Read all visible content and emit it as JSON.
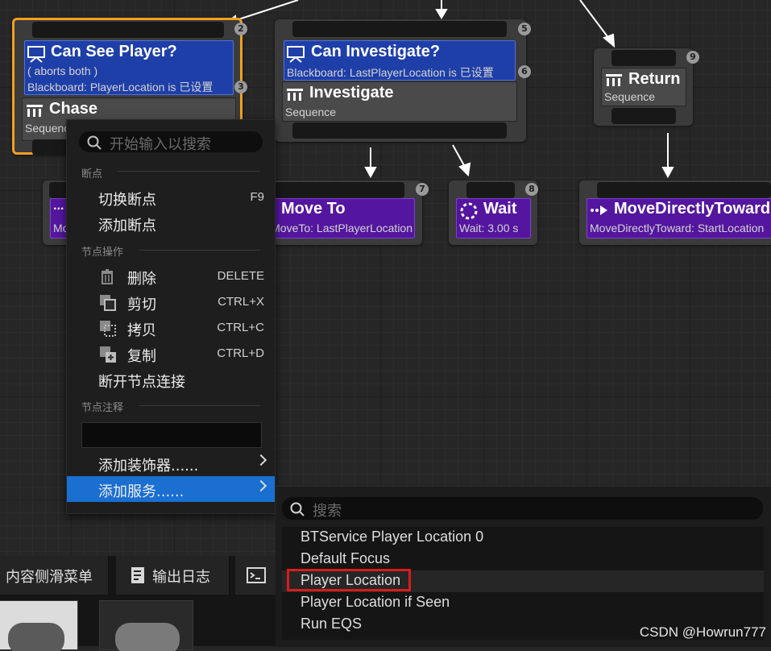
{
  "nodes": {
    "can_see_player": {
      "badge_top": "2",
      "badge_deco": "3",
      "decorator_title": "Can See Player?",
      "decorator_line1": "( aborts both )",
      "decorator_line2": "Blackboard: PlayerLocation is 已设置",
      "composite_title": "Chase",
      "composite_sub": "Sequence"
    },
    "can_investigate": {
      "badge_top": "5",
      "badge_deco": "6",
      "decorator_title": "Can Investigate?",
      "decorator_line1": "Blackboard: LastPlayerLocation is 已设置",
      "composite_title": "Investigate",
      "composite_sub": "Sequence"
    },
    "return": {
      "badge": "9",
      "title": "Return",
      "sub": "Sequence"
    },
    "left_task": {
      "title": "...",
      "sub": "Mo"
    },
    "move_to": {
      "badge": "7",
      "title": "Move To",
      "sub": "MoveTo: LastPlayerLocation"
    },
    "wait": {
      "badge": "8",
      "title": "Wait",
      "sub": "Wait: 3.00 s"
    },
    "move_directly": {
      "title": "MoveDirectlyToward",
      "sub": "MoveDirectlyToward: StartLocation"
    }
  },
  "context_menu": {
    "search_placeholder": "开始输入以搜索",
    "section_breakpoints": "断点",
    "toggle_breakpoint": "切换断点",
    "toggle_breakpoint_shortcut": "F9",
    "add_breakpoint": "添加断点",
    "section_node_actions": "节点操作",
    "delete": "删除",
    "delete_shortcut": "DELETE",
    "cut": "剪切",
    "cut_shortcut": "CTRL+X",
    "copy": "拷贝",
    "copy_shortcut": "CTRL+C",
    "duplicate": "复制",
    "duplicate_shortcut": "CTRL+D",
    "break_links": "断开节点连接",
    "section_node_comment": "节点注释",
    "comment_value": "",
    "add_decorator": "添加装饰器......",
    "add_service": "添加服务......"
  },
  "service_submenu": {
    "search_placeholder": "搜索",
    "items": [
      "BTService Player Location 0",
      "Default Focus",
      "Player Location",
      "Player Location if Seen",
      "Run EQS"
    ],
    "highlighted": "Player Location"
  },
  "bottom_tabs": {
    "content_drawer": "内容侧滑菜单",
    "output_log": "输出日志"
  },
  "watermark": "CSDN @Howrun777",
  "colors": {
    "decorator_blue": "#1f3fa8",
    "task_purple": "#54169e",
    "selected_outline": "#f0a020",
    "menu_selected": "#1a6fd0",
    "highlight_box": "#d81c1c"
  }
}
